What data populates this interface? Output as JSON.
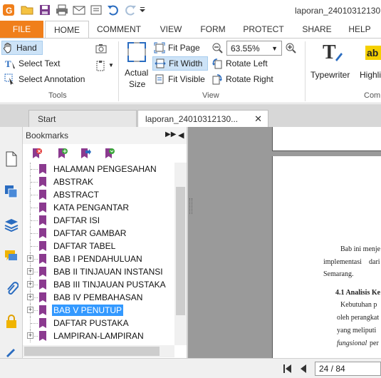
{
  "window": {
    "title": "laporan_24010312130"
  },
  "ribbon_tabs": [
    {
      "label": "FILE"
    },
    {
      "label": "HOME"
    },
    {
      "label": "COMMENT"
    },
    {
      "label": "VIEW"
    },
    {
      "label": "FORM"
    },
    {
      "label": "PROTECT"
    },
    {
      "label": "SHARE"
    },
    {
      "label": "HELP"
    }
  ],
  "tools": {
    "hand": "Hand",
    "select_text": "Select Text",
    "select_annotation": "Select Annotation",
    "group_label": "Tools"
  },
  "view": {
    "actual_size_line1": "Actual",
    "actual_size_line2": "Size",
    "fit_page": "Fit Page",
    "fit_width": "Fit Width",
    "fit_visible": "Fit Visible",
    "rotate_left": "Rotate Left",
    "rotate_right": "Rotate Right",
    "zoom": "63.55%",
    "group_label": "View"
  },
  "comment": {
    "typewriter": "Typewriter",
    "highlight": "Highli",
    "group_label": "Comm"
  },
  "doc_tabs": [
    {
      "label": "Start"
    },
    {
      "label": "laporan_24010312130..."
    }
  ],
  "bookmarks": {
    "title": "Bookmarks",
    "items": [
      {
        "label": "HALAMAN PENGESAHAN",
        "expandable": false
      },
      {
        "label": "ABSTRAK",
        "expandable": false
      },
      {
        "label": "ABSTRACT",
        "expandable": false
      },
      {
        "label": "KATA PENGANTAR",
        "expandable": false
      },
      {
        "label": "DAFTAR ISI",
        "expandable": false
      },
      {
        "label": "DAFTAR GAMBAR",
        "expandable": false
      },
      {
        "label": "DAFTAR TABEL",
        "expandable": false
      },
      {
        "label": "BAB I PENDAHULUAN",
        "expandable": true
      },
      {
        "label": "BAB II TINJAUAN INSTANSI",
        "expandable": true
      },
      {
        "label": "BAB III TINJAUAN PUSTAKA",
        "expandable": true
      },
      {
        "label": "BAB IV PEMBAHASAN",
        "expandable": true
      },
      {
        "label": "BAB V PENUTUP",
        "expandable": true,
        "selected": true
      },
      {
        "label": "DAFTAR PUSTAKA",
        "expandable": false
      },
      {
        "label": "LAMPIRAN-LAMPIRAN",
        "expandable": true
      }
    ]
  },
  "document_text": {
    "line1": "Bab ini menje",
    "line2a": "implementasi",
    "line2b": "dari",
    "line3": "Semarang.",
    "heading": "4.1 Analisis Ke",
    "line5": "Kebutuhan p",
    "line6": "oleh perangkat",
    "line7": "yang meliputi",
    "line8a": "fungsional",
    "line8b": "per"
  },
  "status": {
    "page_indicator": "24 / 84"
  },
  "colors": {
    "file_tab": "#f07f1b",
    "selection": "#3399ff",
    "bookmark_flag": "#8b3a8f"
  }
}
